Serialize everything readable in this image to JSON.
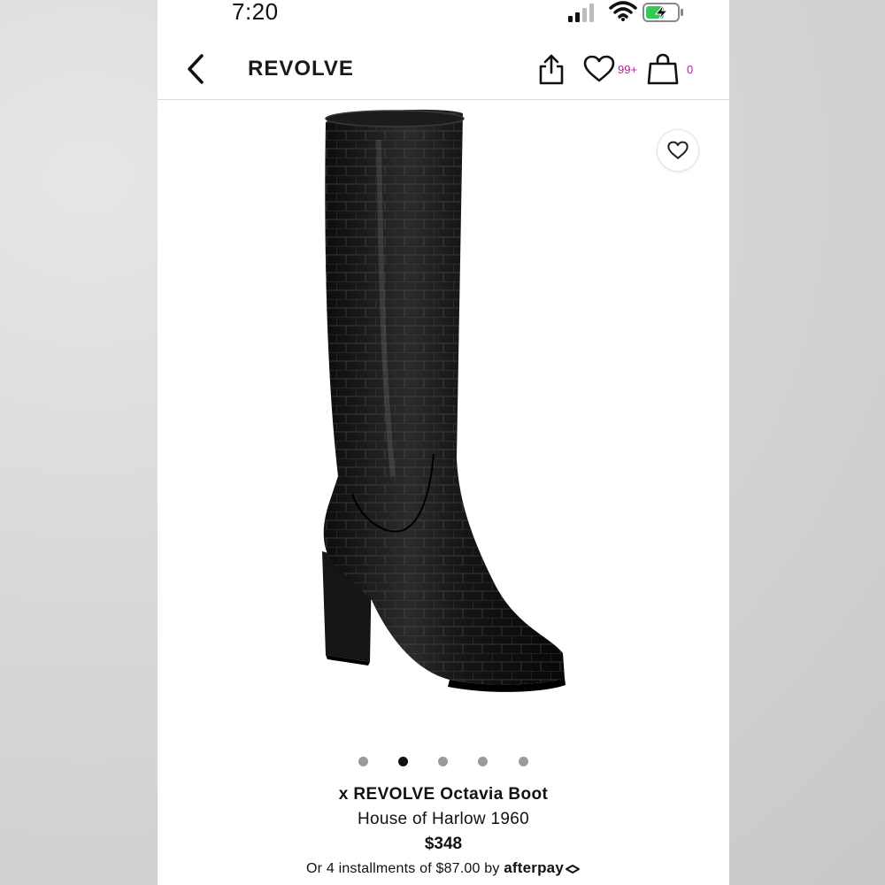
{
  "status_bar": {
    "time": "7:20"
  },
  "nav": {
    "brand": "REVOLVE",
    "wishlist_count": "99+",
    "bag_count": "0",
    "accent_color": "#b3239a"
  },
  "carousel": {
    "total": 5,
    "active_index": 1
  },
  "product": {
    "name": "x REVOLVE Octavia Boot",
    "brand": "House of Harlow 1960",
    "price": "$348",
    "installments_prefix": "Or 4 installments of $87.00 by",
    "installments_provider": "afterpay"
  },
  "icons": {
    "back": "chevron-left-icon",
    "share": "share-icon",
    "wishlist": "heart-icon",
    "bag": "shopping-bag-icon",
    "favorite": "heart-icon"
  }
}
